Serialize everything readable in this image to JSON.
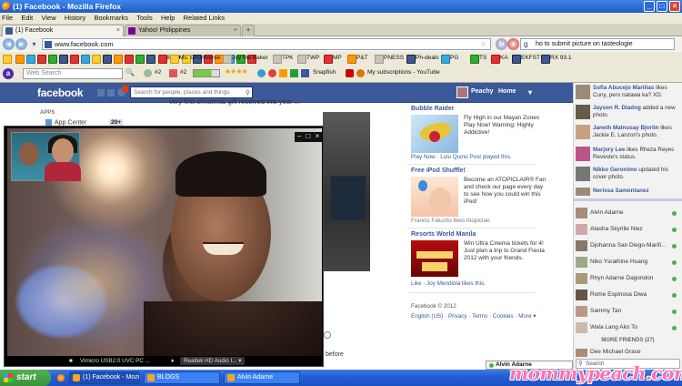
{
  "window": {
    "title": "(1) Facebook - Mozilla Firefox"
  },
  "menu": [
    "File",
    "Edit",
    "View",
    "History",
    "Bookmarks",
    "Tools",
    "Help",
    "Related Links"
  ],
  "tabs": [
    {
      "label": "(1) Facebook",
      "active": true
    },
    {
      "label": "Yahoo! Philippines",
      "active": false
    }
  ],
  "nav": {
    "url": "www.facebook.com",
    "search_value": "ho to submit picture on tasteologie"
  },
  "bookmarks": [
    "BDO",
    "Ms. Chuniverse",
    "Joy the Baker",
    "TPK",
    "TWP",
    "MP",
    "P&T",
    "PNESS",
    "Ph-deals",
    "PG",
    "TS",
    "KA",
    "EKFST",
    "RX 93.1"
  ],
  "toolbar": {
    "search_placeholder": "Web Search",
    "badge1": "#2",
    "badge2": "#2",
    "snapfish": "Snapfish",
    "subscriptions": "My subscriptions - YouTube"
  },
  "facebook": {
    "logo": "facebook",
    "search_placeholder": "Search for people, places and things",
    "user": "Peachy",
    "home": "Home",
    "apps_header": "APPS",
    "app_center": "App Center",
    "app_count": "20+",
    "feed_text": "very first christmas gift received this year ...",
    "before_text": "before",
    "ads": [
      {
        "title": "Bubble Raider",
        "text": "Fly High in our Mayan Zones Play Now! Warning: Highly Addictive!",
        "like": "Play Now · Lulu Quino Post played this."
      },
      {
        "title": "Free iPod Shuffle!",
        "text": "Become an ATOPICLAIR® Fan and check our page every day to see how you could win this iPod!",
        "like": "Francis Falucho likes Atopiclair."
      },
      {
        "title": "Resorts World Manila",
        "text": "Win Ultra Cinema tickets for 4! Just plan a trip to Grand Fiesta 2012 with your friends.",
        "like": "Like · Joy Mendiola likes this."
      }
    ],
    "footer": {
      "copyright": "Facebook © 2012",
      "links": "English (US) · Privacy · Terms · Cookies · More ▾"
    }
  },
  "ticker": [
    {
      "name": "Sofia Abucejo Mariñas",
      "text": "likes Cuny, pero natawa ka? XD."
    },
    {
      "name": "Jayson R. Diadog",
      "text": "added a new photo."
    },
    {
      "name": "Janeth Malnusay Bjorlin",
      "text": "likes Jackie E. Lanzon's photo."
    },
    {
      "name": "Marjory Lee",
      "text": "likes Rheza Reyes Reveste's status."
    },
    {
      "name": "Nikko Geronimo",
      "text": "updated his cover photo."
    },
    {
      "name": "Nerissa Samontanez",
      "text": ""
    }
  ],
  "chat": {
    "friends": [
      "Alvin Adarne",
      "Atasha Skyrille Niez",
      "Djohanna San Diego-Marifi...",
      "Niko Ysrathine Huang",
      "Rhyn Adarne Dagondon",
      "Rome Espinosa Diwa",
      "Sammy Tan",
      "Wala Lang Ako To",
      "Dee Michael Grace"
    ],
    "more_friends": "MORE FRIENDS (27)",
    "search_placeholder": "Search",
    "open_tab": "Alvin Adarne"
  },
  "video_call": {
    "camera": "Vimicro USB2.0 UVC PC ...",
    "mic": "Realtek HD Audio I... ▾"
  },
  "taskbar": {
    "start": "start",
    "items": [
      "(1) Facebook - Mozilla...",
      "BLOGS",
      "Alvin Adarne"
    ]
  },
  "watermark": "mommypeach.com",
  "colors": {
    "fb_blue": "#3b5998",
    "xp_blue": "#245ed8",
    "start_green": "#3a923a",
    "watermark_pink": "#ff6fb0"
  }
}
